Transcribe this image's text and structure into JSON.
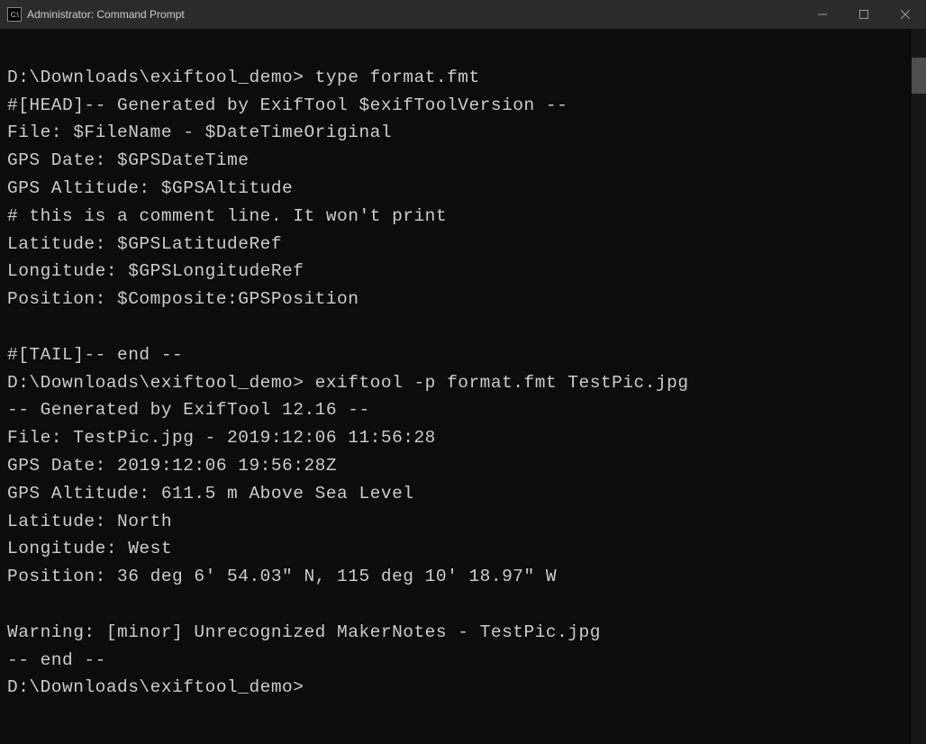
{
  "window": {
    "icon_text": "C:\\",
    "title": "Administrator: Command Prompt"
  },
  "terminal": {
    "lines": [
      "",
      "D:\\Downloads\\exiftool_demo> type format.fmt",
      "#[HEAD]-- Generated by ExifTool $exifToolVersion --",
      "File: $FileName - $DateTimeOriginal",
      "GPS Date: $GPSDateTime",
      "GPS Altitude: $GPSAltitude",
      "# this is a comment line. It won't print",
      "Latitude: $GPSLatitudeRef",
      "Longitude: $GPSLongitudeRef",
      "Position: $Composite:GPSPosition",
      "",
      "#[TAIL]-- end --",
      "D:\\Downloads\\exiftool_demo> exiftool -p format.fmt TestPic.jpg",
      "-- Generated by ExifTool 12.16 --",
      "File: TestPic.jpg - 2019:12:06 11:56:28",
      "GPS Date: 2019:12:06 19:56:28Z",
      "GPS Altitude: 611.5 m Above Sea Level",
      "Latitude: North",
      "Longitude: West",
      "Position: 36 deg 6' 54.03\" N, 115 deg 10' 18.97\" W",
      "",
      "Warning: [minor] Unrecognized MakerNotes - TestPic.jpg",
      "-- end --",
      "D:\\Downloads\\exiftool_demo>"
    ]
  }
}
